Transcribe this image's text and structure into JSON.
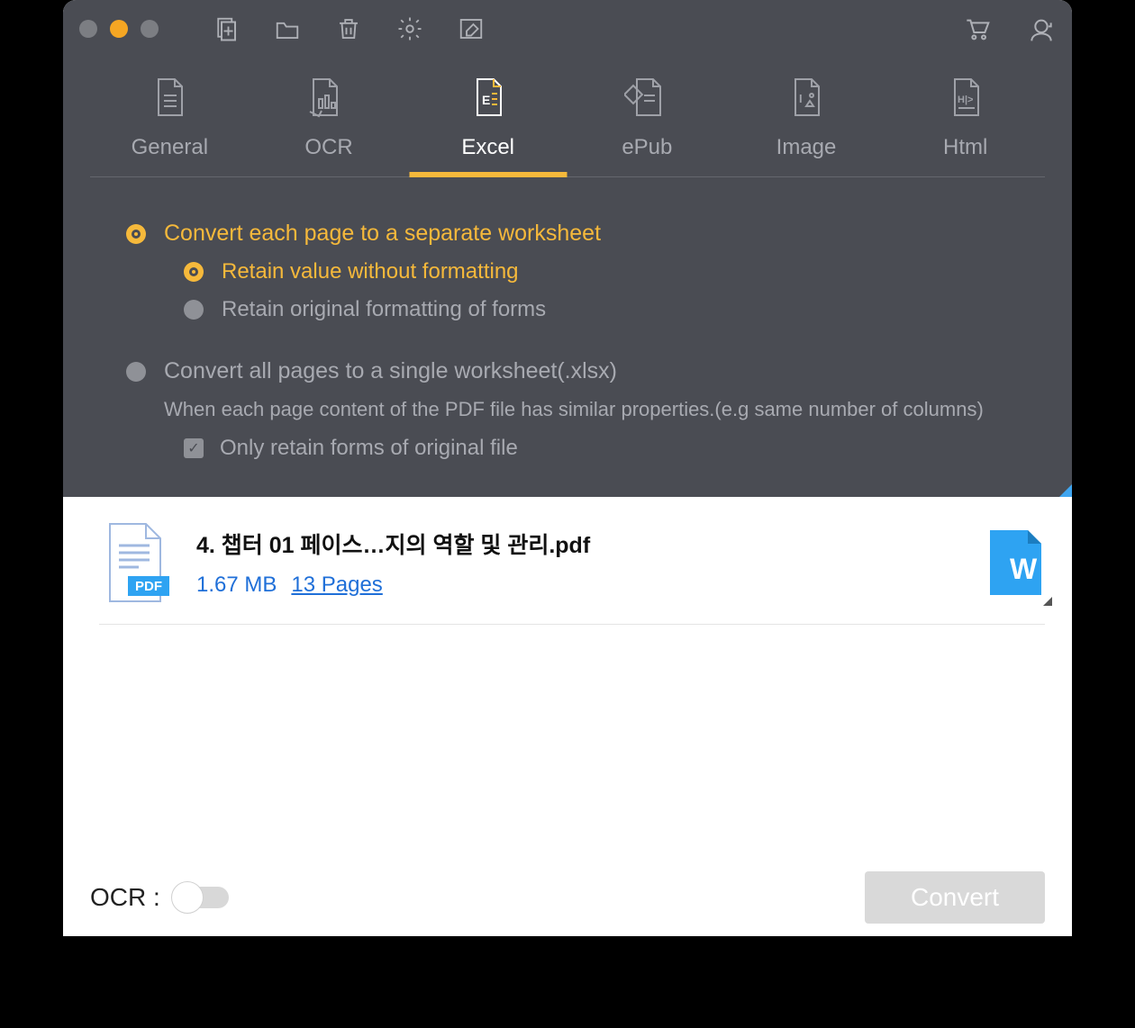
{
  "tabs": {
    "general": "General",
    "ocr": "OCR",
    "excel": "Excel",
    "epub": "ePub",
    "image": "Image",
    "html": "Html"
  },
  "options": {
    "opt1": "Convert each page to a separate worksheet",
    "opt1a": "Retain value without formatting",
    "opt1b": "Retain original formatting of forms",
    "opt2": "Convert all pages to a single worksheet(.xlsx)",
    "opt2desc": "When each page content of the PDF file has similar properties.(e.g same number of columns)",
    "opt2chk": "Only retain forms of original file"
  },
  "file": {
    "name": "4. 챕터 01 페이스…지의 역할 및 관리.pdf",
    "size": "1.67 MB",
    "pages": "13 Pages"
  },
  "footer": {
    "ocr": "OCR :",
    "convert": "Convert"
  }
}
